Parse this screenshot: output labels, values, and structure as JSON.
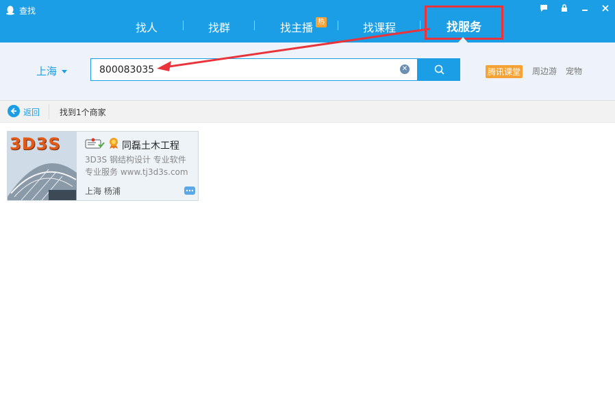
{
  "window": {
    "title": "查找",
    "controls": [
      "feedback-icon",
      "lock-icon",
      "minimize-icon",
      "close-icon"
    ]
  },
  "tabs": [
    {
      "label": "找人"
    },
    {
      "label": "找群"
    },
    {
      "label": "找主播",
      "badge": "热"
    },
    {
      "label": "找课程"
    },
    {
      "label": "找服务",
      "active": true
    }
  ],
  "search": {
    "city": "上海",
    "value": "800083035",
    "quick_links": [
      "腾讯课堂",
      "周边游",
      "宠物"
    ]
  },
  "nav": {
    "back_label": "返回",
    "result_text": "找到1个商家"
  },
  "results": [
    {
      "logo_text": "3D3S",
      "name": "同磊土木工程",
      "desc1": "3D3S 钢结构设计 专业软件",
      "desc2": "专业服务 www.tj3d3s.com",
      "location": "上海 杨浦"
    }
  ],
  "colors": {
    "accent": "#1b9ee6",
    "highlight": "#e8343a",
    "hot_badge": "#f7a234"
  }
}
